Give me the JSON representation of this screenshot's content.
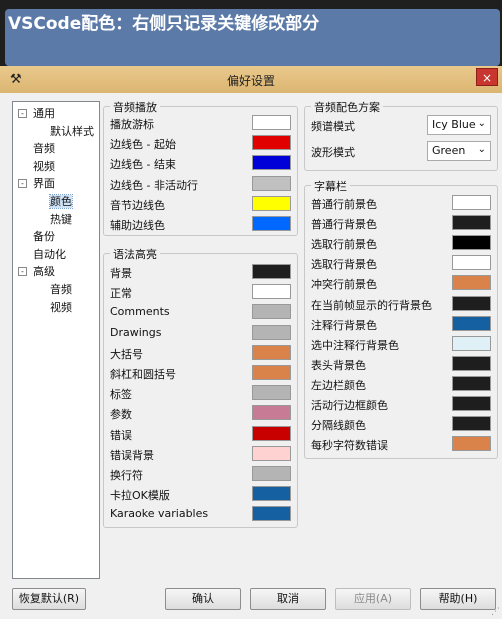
{
  "banner": {
    "text": "VSCode配色：右侧只记录关键修改部分"
  },
  "window": {
    "title": "偏好设置",
    "close": "×"
  },
  "tree": [
    {
      "label": "通用",
      "level": 0,
      "exp": "-"
    },
    {
      "label": "默认样式",
      "level": 1
    },
    {
      "label": "音频",
      "level": 0
    },
    {
      "label": "视频",
      "level": 0
    },
    {
      "label": "界面",
      "level": 0,
      "exp": "-"
    },
    {
      "label": "颜色",
      "level": 1,
      "selected": true
    },
    {
      "label": "热键",
      "level": 1
    },
    {
      "label": "备份",
      "level": 0
    },
    {
      "label": "自动化",
      "level": 0
    },
    {
      "label": "高级",
      "level": 0,
      "exp": "-"
    },
    {
      "label": "音频",
      "level": 1
    },
    {
      "label": "视频",
      "level": 1
    }
  ],
  "audio_playback": {
    "title": "音频播放",
    "items": [
      {
        "label": "播放游标",
        "color": "#ffffff"
      },
      {
        "label": "边线色 - 起始",
        "color": "#e00000"
      },
      {
        "label": "边线色 - 结束",
        "color": "#0000d8"
      },
      {
        "label": "边线色 - 非活动行",
        "color": "#c0c0c0"
      },
      {
        "label": "音节边线色",
        "color": "#ffff00"
      },
      {
        "label": "辅助边线色",
        "color": "#0068ff"
      }
    ]
  },
  "syntax": {
    "title": "语法高亮",
    "items": [
      {
        "label": "背景",
        "color": "#1e1e1e"
      },
      {
        "label": "正常",
        "color": "#ffffff"
      },
      {
        "label": "Comments",
        "color": "#b4b4b4"
      },
      {
        "label": "Drawings",
        "color": "#b4b4b4"
      },
      {
        "label": "大括号",
        "color": "#d9824a"
      },
      {
        "label": "斜杠和圆括号",
        "color": "#d9824a"
      },
      {
        "label": "标签",
        "color": "#b4b4b4"
      },
      {
        "label": "参数",
        "color": "#c77b95"
      },
      {
        "label": "错误",
        "color": "#c80000"
      },
      {
        "label": "错误背景",
        "color": "#ffd2d2"
      },
      {
        "label": "换行符",
        "color": "#b4b4b4"
      },
      {
        "label": "卡拉OK模版",
        "color": "#1560a0"
      },
      {
        "label": "Karaoke variables",
        "color": "#1560a0"
      }
    ]
  },
  "audio_scheme": {
    "title": "音频配色方案",
    "items": [
      {
        "label": "频谱模式",
        "value": "Icy Blue"
      },
      {
        "label": "波形模式",
        "value": "Green"
      }
    ]
  },
  "subtitles": {
    "title": "字幕栏",
    "items": [
      {
        "label": "普通行前景色",
        "color": "#ffffff"
      },
      {
        "label": "普通行背景色",
        "color": "#1e1e1e"
      },
      {
        "label": "选取行前景色",
        "color": "#000000"
      },
      {
        "label": "选取行背景色",
        "color": "#ffffff"
      },
      {
        "label": "冲突行前景色",
        "color": "#d9824a"
      },
      {
        "label": "在当前帧显示的行背景色",
        "color": "#1e1e1e"
      },
      {
        "label": "注释行背景色",
        "color": "#1560a0"
      },
      {
        "label": "选中注释行背景色",
        "color": "#dff0f6"
      },
      {
        "label": "表头背景色",
        "color": "#1e1e1e"
      },
      {
        "label": "左边栏颜色",
        "color": "#1e1e1e"
      },
      {
        "label": "活动行边框颜色",
        "color": "#1e1e1e"
      },
      {
        "label": "分隔线颜色",
        "color": "#1e1e1e"
      },
      {
        "label": "每秒字符数错误",
        "color": "#d9824a"
      }
    ]
  },
  "buttons": {
    "restore": "恢复默认(R)",
    "ok": "确认",
    "cancel": "取消",
    "apply": "应用(A)",
    "help": "帮助(H)"
  }
}
